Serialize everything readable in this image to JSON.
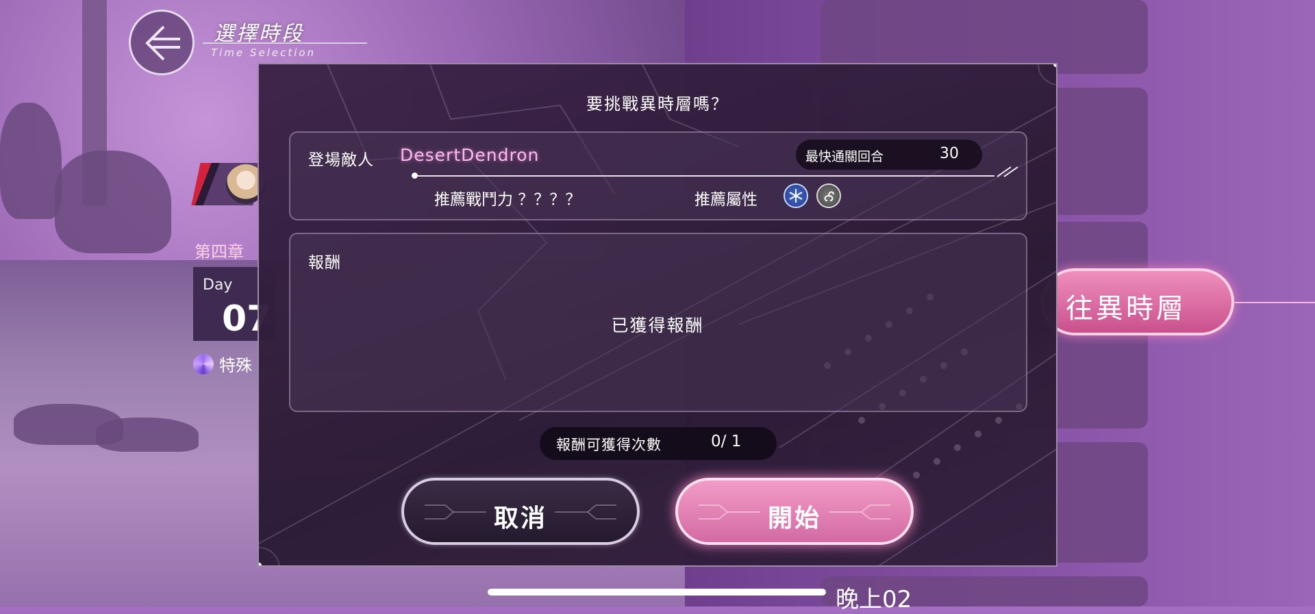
{
  "nav": {
    "title": "選擇時段",
    "subtitle": "Time Selection"
  },
  "side": {
    "chapter": "第四章",
    "day_label": "Day",
    "day_number": "07",
    "special": "特殊",
    "goto_button": "往異時層",
    "night_slot": "晚上02"
  },
  "dialog": {
    "title": "要挑戰異時層嗎？",
    "enemy_label": "登場敵人",
    "enemy_name": "DesertDendron",
    "fastest_label": "最快通關回合",
    "fastest_value": "30",
    "power_text": "推薦戰鬥力 ？？？？",
    "attr_label": "推薦屬性",
    "attr_icons": [
      "ice-icon",
      "wind-icon"
    ],
    "reward_label": "報酬",
    "reward_status": "已獲得報酬",
    "count_label": "報酬可獲得次數",
    "count_value": "0/ 1",
    "cancel_label": "取消",
    "start_label": "開始"
  },
  "colors": {
    "accent_pink": "#f29cc7",
    "enemy_name": "#ffb9ef",
    "panel_dark": "#2a1a34"
  }
}
